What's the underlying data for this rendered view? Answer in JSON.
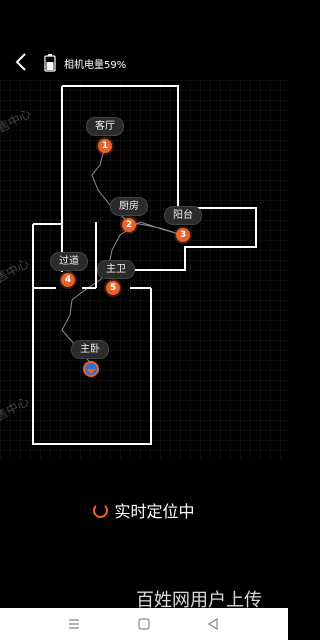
{
  "header": {
    "back_icon": "chevron-left-icon",
    "battery_icon": "battery-icon",
    "battery_text": "相机电量59%",
    "battery_level": 0.59
  },
  "watermarks": [
    "售中心",
    "售中心",
    "售中心"
  ],
  "rooms": [
    {
      "label": "客厅",
      "number": "1"
    },
    {
      "label": "厨房",
      "number": "2"
    },
    {
      "label": "阳台",
      "number": "3"
    },
    {
      "label": "过道",
      "number": "4"
    },
    {
      "label": "主卫",
      "number": "5"
    },
    {
      "label": "主卧"
    }
  ],
  "status": {
    "text": "实时定位中"
  },
  "upload_watermark": "百姓网用户上传",
  "navbar": {
    "menu_icon": "menu-icon",
    "home_icon": "square-icon",
    "back_icon": "triangle-back-icon"
  },
  "colors": {
    "accent": "#e8622c",
    "background": "#000000",
    "walls": "#ffffff"
  }
}
